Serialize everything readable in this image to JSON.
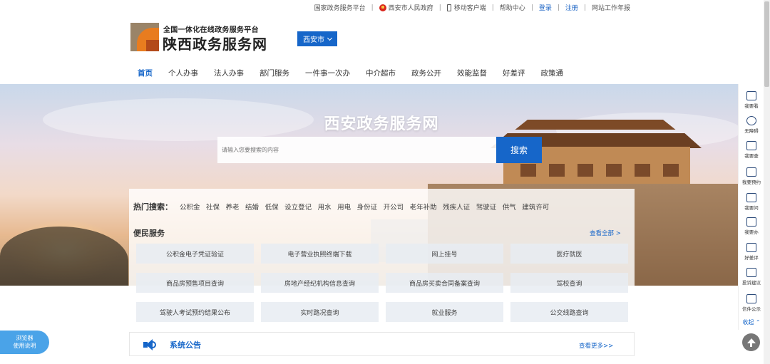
{
  "topbar": {
    "links": [
      {
        "label": "国家政务服务平台",
        "icon": ""
      },
      {
        "label": "西安市人民政府",
        "icon": "emblem-icon"
      },
      {
        "label": "移动客户端",
        "icon": "phone-icon"
      },
      {
        "label": "帮助中心",
        "icon": ""
      },
      {
        "label": "登录",
        "icon": ""
      },
      {
        "label": "注册",
        "icon": ""
      },
      {
        "label": "网站工作年报",
        "icon": ""
      }
    ]
  },
  "header": {
    "logo_subtitle": "全国一体化在线政务服务平台",
    "logo_title": "陕西政务服务网",
    "city": "西安市"
  },
  "nav": [
    "首页",
    "个人办事",
    "法人办事",
    "部门服务",
    "一件事一次办",
    "中介超市",
    "政务公开",
    "效能监督",
    "好差评",
    "政策通"
  ],
  "banner": {
    "title": "西安政务服务网",
    "search_placeholder": "请输入您要搜索的内容",
    "search_button": "搜索"
  },
  "hot_search": {
    "label": "热门搜索：",
    "keywords": [
      "公积金",
      "社保",
      "养老",
      "结婚",
      "低保",
      "设立登记",
      "用水",
      "用电",
      "身份证",
      "开公司",
      "老年补助",
      "残疾人证",
      "驾驶证",
      "供气",
      "建筑许可"
    ]
  },
  "services": {
    "title": "便民服务",
    "view_all": "查看全部 >",
    "items": [
      "公积金电子凭证验证",
      "电子营业执照终端下载",
      "网上挂号",
      "医疗就医",
      "商品房预售项目查询",
      "房地产经纪机构信息查询",
      "商品房买卖合同备案查询",
      "驾校查询",
      "驾驶人考试预约结果公布",
      "实时路况查询",
      "就业服务",
      "公交线路查询"
    ]
  },
  "notice": {
    "title": "系统公告",
    "more": "查看更多>>"
  },
  "right_sidebar": {
    "items": [
      {
        "label": "我要看",
        "icon": "eye-icon"
      },
      {
        "label": "无障碍",
        "icon": "accessibility-icon"
      },
      {
        "label": "我要查",
        "icon": "search-doc-icon"
      },
      {
        "label": "我要预约",
        "icon": "calendar-icon"
      },
      {
        "label": "我要问",
        "icon": "question-icon"
      },
      {
        "label": "我要办",
        "icon": "briefcase-icon"
      },
      {
        "label": "好差评",
        "icon": "comment-icon"
      },
      {
        "label": "投诉建议",
        "icon": "mail-icon"
      },
      {
        "label": "信件公示",
        "icon": "letter-icon"
      }
    ],
    "collapse": "收起"
  },
  "browser_tip": {
    "line1": "浏览器",
    "line2": "使用说明"
  },
  "colors": {
    "primary": "#1666c9",
    "sidebar_icon": "#2b4a7a"
  }
}
